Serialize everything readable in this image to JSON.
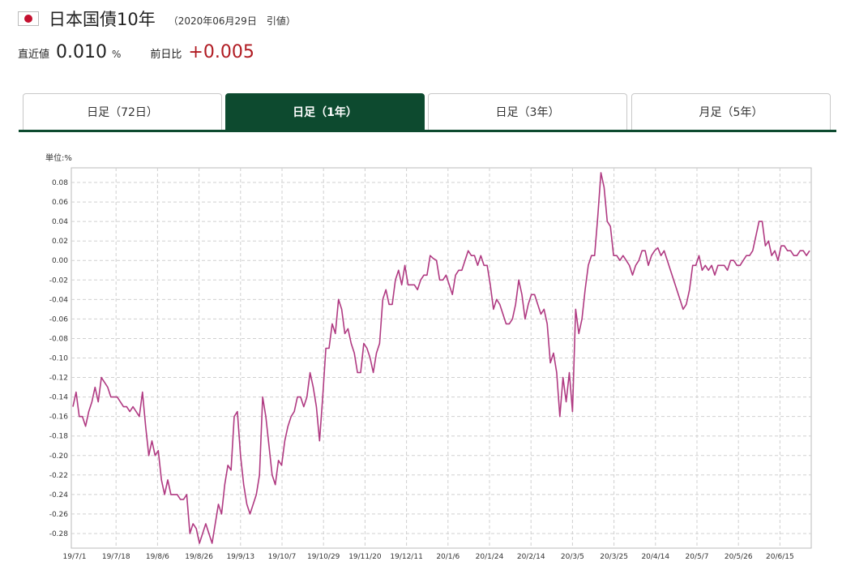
{
  "header": {
    "title": "日本国債10年",
    "date": "（2020年06月29日",
    "session": "引値）"
  },
  "quote": {
    "latest_label": "直近値",
    "latest_value": "0.010",
    "unit": "%",
    "prev_label": "前日比",
    "change": "+0.005",
    "change_color": "#b01b22"
  },
  "tabs": [
    {
      "label": "日足（72日）",
      "active": false
    },
    {
      "label": "日足（1年）",
      "active": true
    },
    {
      "label": "日足（3年）",
      "active": false
    },
    {
      "label": "月足（5年）",
      "active": false
    }
  ],
  "chart_data": {
    "type": "line",
    "unit_label": "単位:%",
    "grid": true,
    "ylim": [
      -0.295,
      0.095
    ],
    "y_ticks": [
      0.08,
      0.06,
      0.04,
      0.02,
      0.0,
      -0.02,
      -0.04,
      -0.06,
      -0.08,
      -0.1,
      -0.12,
      -0.14,
      -0.16,
      -0.18,
      -0.2,
      -0.22,
      -0.24,
      -0.26,
      -0.28
    ],
    "y_tick_labels": [
      "0.08",
      "0.06",
      "0.04",
      "0.02",
      "0.00",
      "-0.02",
      "-0.04",
      "-0.06",
      "-0.08",
      "-0.10",
      "-0.12",
      "-0.14",
      "-0.16",
      "-0.18",
      "-0.20",
      "-0.22",
      "-0.24",
      "-0.26",
      "-0.28"
    ],
    "x_tick_labels": [
      "19/7/1",
      "19/7/18",
      "19/8/6",
      "19/8/26",
      "19/9/13",
      "19/10/7",
      "19/10/29",
      "19/11/20",
      "19/12/11",
      "20/1/6",
      "20/1/24",
      "20/2/14",
      "20/3/5",
      "20/3/25",
      "20/4/14",
      "20/5/7",
      "20/5/26",
      "20/6/15"
    ],
    "line_color": "#b03a82",
    "series": [
      {
        "values": [
          -0.15,
          -0.135,
          -0.16,
          -0.16,
          -0.17,
          -0.155,
          -0.145,
          -0.13,
          -0.145,
          -0.12,
          -0.125,
          -0.13,
          -0.14,
          -0.14,
          -0.14,
          -0.145,
          -0.15,
          -0.15,
          -0.155,
          -0.15,
          -0.155,
          -0.16,
          -0.135,
          -0.17,
          -0.2,
          -0.185,
          -0.2,
          -0.195,
          -0.225,
          -0.24,
          -0.225,
          -0.24,
          -0.24,
          -0.24,
          -0.245,
          -0.245,
          -0.24,
          -0.28,
          -0.27,
          -0.275,
          -0.29,
          -0.28,
          -0.27,
          -0.28,
          -0.29,
          -0.27,
          -0.25,
          -0.26,
          -0.23,
          -0.21,
          -0.215,
          -0.16,
          -0.155,
          -0.2,
          -0.23,
          -0.25,
          -0.26,
          -0.25,
          -0.24,
          -0.22,
          -0.14,
          -0.16,
          -0.19,
          -0.22,
          -0.23,
          -0.205,
          -0.21,
          -0.185,
          -0.17,
          -0.16,
          -0.155,
          -0.14,
          -0.14,
          -0.15,
          -0.14,
          -0.115,
          -0.13,
          -0.15,
          -0.185,
          -0.14,
          -0.09,
          -0.09,
          -0.065,
          -0.075,
          -0.04,
          -0.05,
          -0.075,
          -0.07,
          -0.085,
          -0.095,
          -0.115,
          -0.115,
          -0.085,
          -0.09,
          -0.1,
          -0.115,
          -0.095,
          -0.085,
          -0.04,
          -0.03,
          -0.045,
          -0.045,
          -0.02,
          -0.01,
          -0.025,
          -0.005,
          -0.025,
          -0.025,
          -0.025,
          -0.03,
          -0.02,
          -0.015,
          -0.015,
          0.005,
          0.002,
          0.0,
          -0.02,
          -0.02,
          -0.015,
          -0.025,
          -0.035,
          -0.015,
          -0.01,
          -0.01,
          0.0,
          0.01,
          0.005,
          0.005,
          -0.005,
          0.005,
          -0.005,
          -0.005,
          -0.025,
          -0.05,
          -0.04,
          -0.045,
          -0.055,
          -0.065,
          -0.065,
          -0.06,
          -0.045,
          -0.02,
          -0.035,
          -0.06,
          -0.045,
          -0.035,
          -0.035,
          -0.045,
          -0.055,
          -0.05,
          -0.065,
          -0.105,
          -0.095,
          -0.115,
          -0.16,
          -0.12,
          -0.145,
          -0.115,
          -0.155,
          -0.05,
          -0.075,
          -0.06,
          -0.03,
          -0.005,
          0.005,
          0.005,
          0.045,
          0.09,
          0.075,
          0.04,
          0.035,
          0.005,
          0.005,
          0.0,
          0.005,
          0.0,
          -0.005,
          -0.015,
          -0.005,
          0.0,
          0.01,
          0.01,
          -0.005,
          0.005,
          0.01,
          0.013,
          0.005,
          0.01,
          0.0,
          -0.01,
          -0.02,
          -0.03,
          -0.04,
          -0.05,
          -0.045,
          -0.03,
          -0.005,
          -0.005,
          0.005,
          -0.01,
          -0.005,
          -0.01,
          -0.005,
          -0.015,
          -0.005,
          -0.005,
          -0.005,
          -0.01,
          0.0,
          0.0,
          -0.005,
          -0.005,
          0.0,
          0.005,
          0.005,
          0.01,
          0.025,
          0.04,
          0.04,
          0.015,
          0.02,
          0.005,
          0.01,
          0.0,
          0.015,
          0.015,
          0.01,
          0.01,
          0.005,
          0.005,
          0.01,
          0.01,
          0.005,
          0.01
        ]
      }
    ]
  }
}
